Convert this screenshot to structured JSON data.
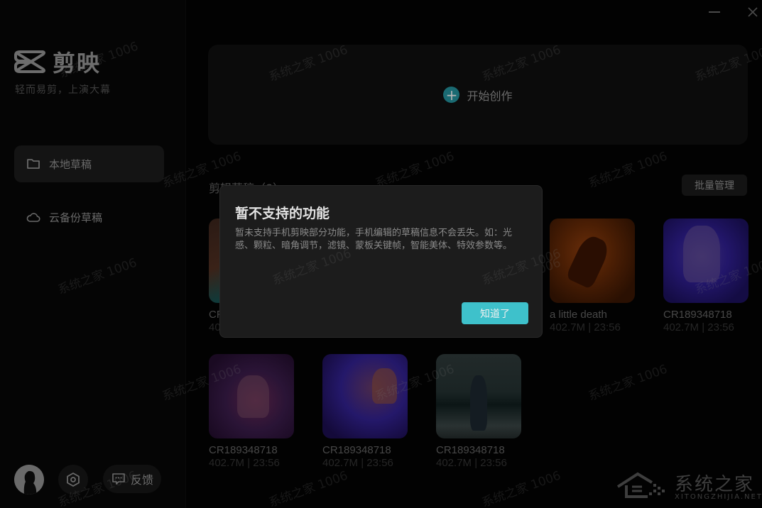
{
  "app": {
    "name": "剪映",
    "tagline": "轻而易剪，上演大幕"
  },
  "window_controls": {
    "minimize_icon": "minimize-icon",
    "close_icon": "close-icon"
  },
  "sidebar": {
    "items": [
      {
        "label": "本地草稿",
        "icon": "folder-icon",
        "active": true
      },
      {
        "label": "云备份草稿",
        "icon": "cloud-icon",
        "active": false
      }
    ],
    "footer": {
      "avatar_icon": "avatar-icon",
      "settings_icon": "settings-icon",
      "feedback_label": "反馈",
      "feedback_icon": "chat-icon"
    }
  },
  "main": {
    "create_label": "开始创作",
    "create_icon": "plus-icon",
    "section_title": "剪辑草稿（8）",
    "batch_manage_label": "批量管理",
    "drafts": [
      {
        "name": "CR189348718",
        "meta": "402.7M | 23:56"
      },
      {
        "name": "a little death",
        "meta": "402.7M | 23:56"
      },
      {
        "name": "CR189348718",
        "meta": "402.7M | 23:56"
      },
      {
        "name": "CR189348718",
        "meta": "402.7M | 23:56"
      },
      {
        "name": "CR189348718",
        "meta": "402.7M | 23:56"
      },
      {
        "name": "CR189348718",
        "meta": "402.7M | 23:56"
      }
    ]
  },
  "dialog": {
    "title": "暂不支持的功能",
    "body": "暂未支持手机剪映部分功能，手机编辑的草稿信息不会丢失。如：光感、颗粒、暗角调节，滤镜、蒙板关键帧，智能美体、特效参数等。",
    "ok_label": "知道了"
  },
  "watermark": {
    "text": "系统之家 1006",
    "brand_main": "系统之家",
    "brand_sub": "XITONGZHIJIA.NET"
  }
}
